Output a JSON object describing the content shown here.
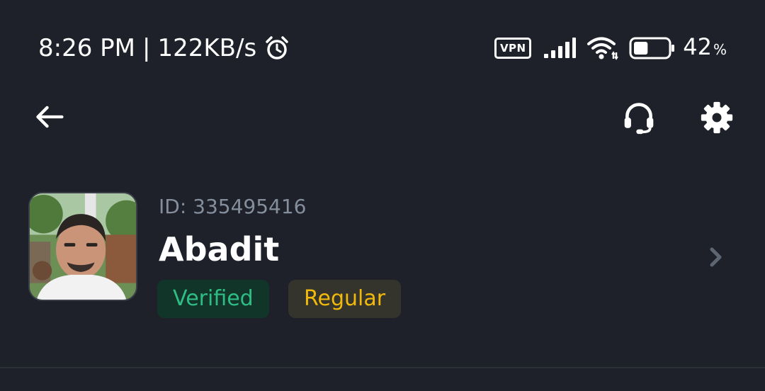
{
  "status_bar": {
    "time": "8:26 PM",
    "separator": "|",
    "network_speed": "122KB/s",
    "vpn_label": "VPN",
    "battery_percent": "42",
    "battery_percent_sign": "%",
    "battery_level": 0.42,
    "icons": [
      "alarm-icon",
      "vpn-icon",
      "signal-icon",
      "wifi-icon",
      "battery-icon"
    ]
  },
  "toolbar": {
    "icons": [
      "back-arrow-icon",
      "headset-icon",
      "gear-icon"
    ]
  },
  "profile": {
    "id_text": "ID: 335495416",
    "name": "Abadit",
    "badges": [
      {
        "label": "Verified",
        "color": "#2ebd85",
        "background": "#12352a"
      },
      {
        "label": "Regular",
        "color": "#f0b90b",
        "background": "#35342c"
      }
    ],
    "chevron_icon": "chevron-right-icon"
  },
  "colors": {
    "background": "#1e2129",
    "text_primary": "#ffffff",
    "text_secondary": "#848e9c",
    "divider": "#2b2f36"
  }
}
